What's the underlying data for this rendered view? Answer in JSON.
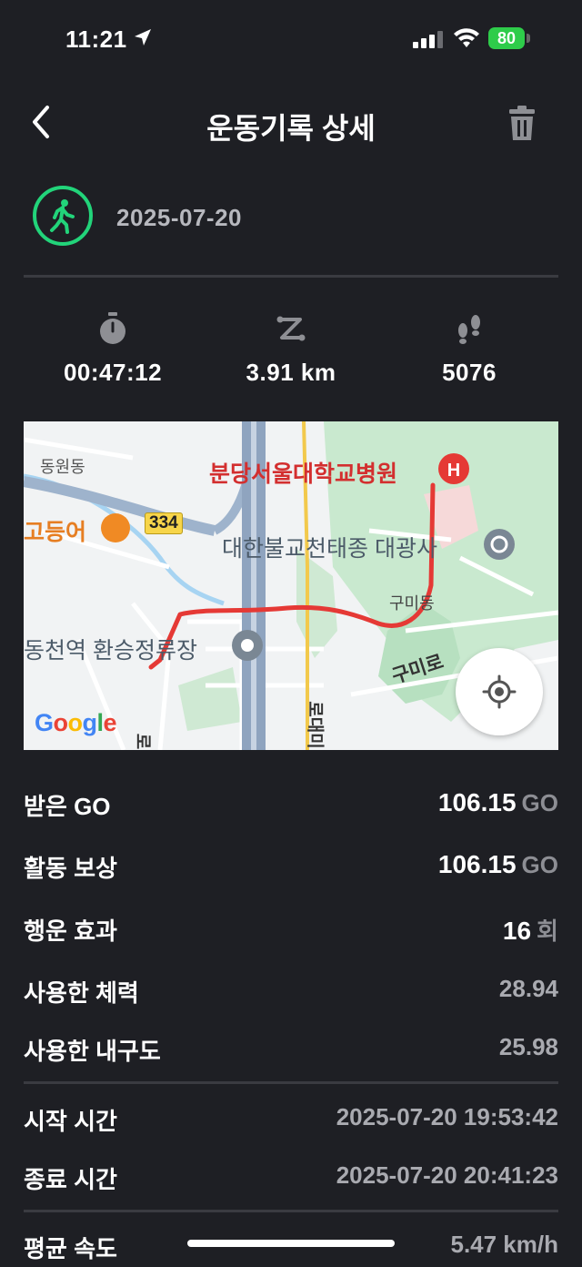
{
  "status_bar": {
    "time": "11:21",
    "battery": "80"
  },
  "header": {
    "title": "운동기록 상세"
  },
  "activity": {
    "date": "2025-07-20",
    "icon": "walking-icon",
    "accent_color": "#22d47a"
  },
  "stats": [
    {
      "icon": "stopwatch-icon",
      "value": "00:47:12"
    },
    {
      "icon": "distance-icon",
      "value": "3.91 km"
    },
    {
      "icon": "footsteps-icon",
      "value": "5076"
    }
  ],
  "map": {
    "labels": {
      "dongwon": "동원동",
      "hospital": "분당서울대학교병원",
      "gomeal": "고등어",
      "route_number": "334",
      "temple": "대한불교천태종 대광사",
      "gumi_dong": "구미동",
      "station": "동천역 환승정류장",
      "gumi_ro": "구미로",
      "road_vertical": "로대미",
      "road_small": "로",
      "brand": "Google"
    },
    "route_color": "#e53935"
  },
  "details": [
    {
      "label": "받은 GO",
      "value": "106.15",
      "unit": "GO"
    },
    {
      "label": "활동 보상",
      "value": "106.15",
      "unit": "GO"
    },
    {
      "label": "행운 효과",
      "value": "16",
      "unit": "회"
    },
    {
      "label": "사용한 체력",
      "value": "28.94"
    },
    {
      "label": "사용한 내구도",
      "value": "25.98"
    },
    {
      "label": "시작 시간",
      "value": "2025-07-20 19:53:42"
    },
    {
      "label": "종료 시간",
      "value": "2025-07-20 20:41:23"
    },
    {
      "label": "평균 속도",
      "value": "5.47 km/h"
    }
  ]
}
